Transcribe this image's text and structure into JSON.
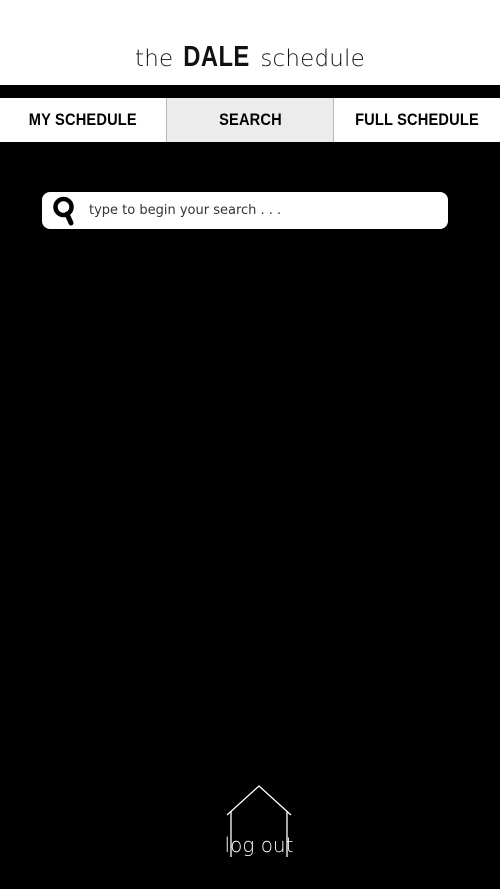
{
  "header": {
    "title_prefix": "the",
    "title_strong": "DALE",
    "title_suffix": "schedule"
  },
  "tabs": [
    {
      "label": "MY SCHEDULE",
      "active": false
    },
    {
      "label": "SEARCH",
      "active": true
    },
    {
      "label": "FULL SCHEDULE",
      "active": false
    }
  ],
  "search": {
    "placeholder": "type to begin your search . . .",
    "value": "",
    "icon": "magnifier-icon"
  },
  "footer": {
    "logout_label": "log out",
    "icon": "house-icon"
  },
  "colors": {
    "background": "#000000",
    "header": "#ffffff",
    "active_tab": "#ececec"
  }
}
